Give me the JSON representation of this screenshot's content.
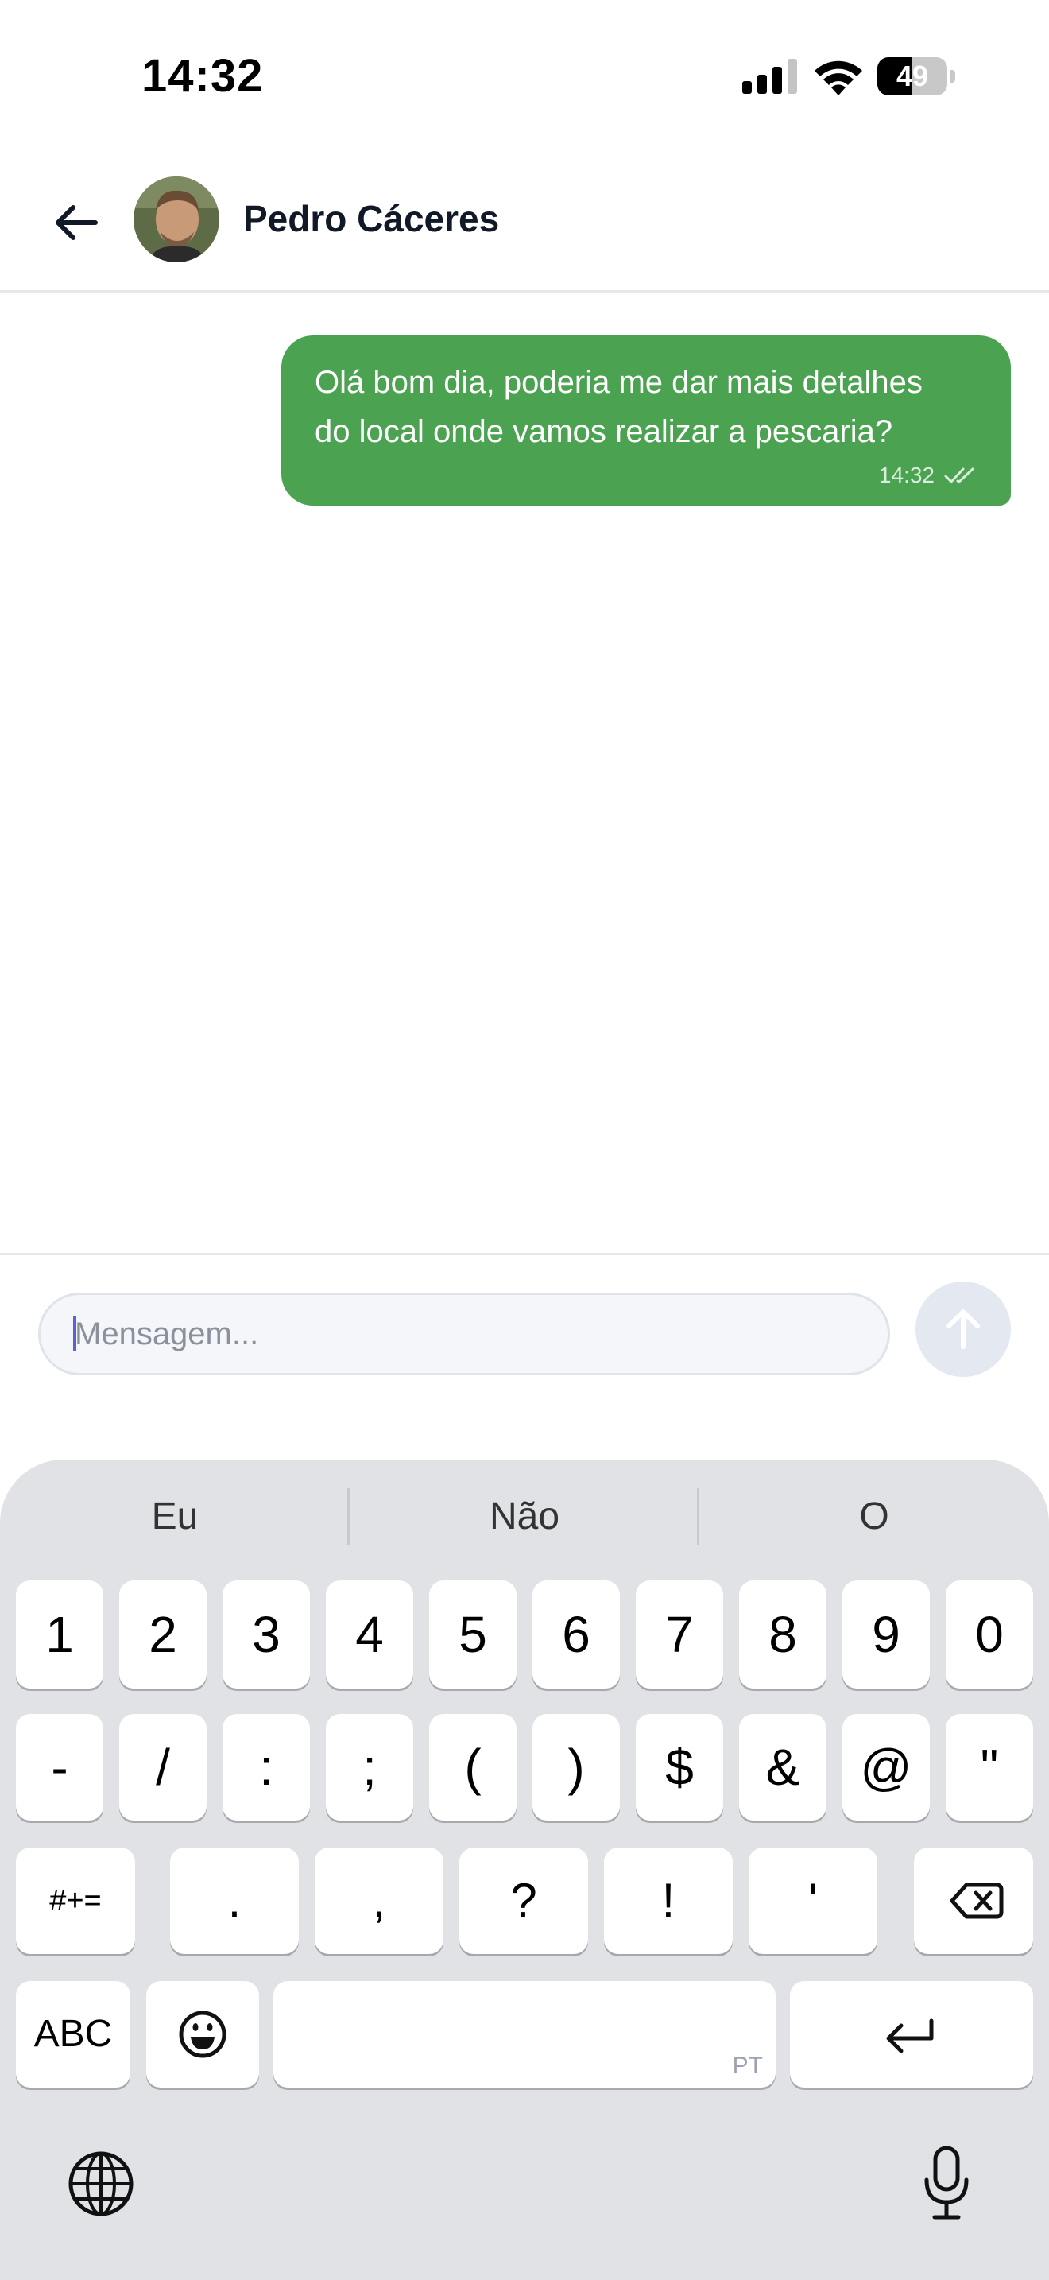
{
  "status_bar": {
    "time": "14:32",
    "battery": "49",
    "battery_level": 0.49
  },
  "header": {
    "contact_name": "Pedro Cáceres"
  },
  "messages": [
    {
      "text_line1": "Olá bom dia, poderia me dar mais detalhes",
      "text_line2": "do local onde vamos realizar a pescaria?",
      "time": "14:32",
      "status_icon": "double-check-icon"
    }
  ],
  "composer": {
    "placeholder": "Mensagem..."
  },
  "keyboard": {
    "suggestions": [
      "Eu",
      "Não",
      "O"
    ],
    "row1": [
      "1",
      "2",
      "3",
      "4",
      "5",
      "6",
      "7",
      "8",
      "9",
      "0"
    ],
    "row2": [
      "-",
      "/",
      ":",
      ";",
      "(",
      ")",
      "$",
      "&",
      "@",
      "\""
    ],
    "row3_mode": "#+=",
    "row3": [
      ".",
      ",",
      "?",
      "!",
      "'"
    ],
    "abc": "ABC",
    "space_lang": "PT"
  },
  "colors": {
    "bubble": "#4ba352",
    "accent": "#5b62d6",
    "send_button": "#e3e8f1"
  }
}
